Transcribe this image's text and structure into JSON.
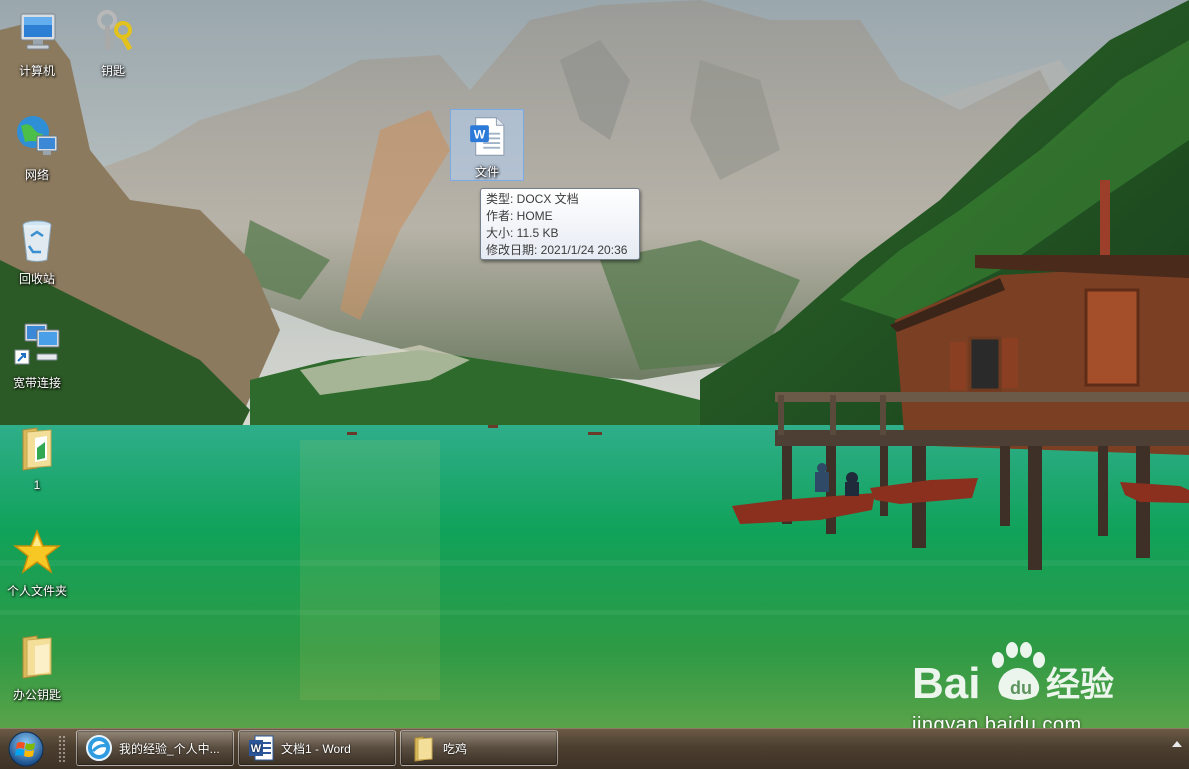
{
  "desktop": {
    "icons": [
      {
        "label": "计算机",
        "icon": "computer-icon"
      },
      {
        "label": "钥匙",
        "icon": "keys-icon"
      },
      {
        "label": "网络",
        "icon": "network-icon"
      },
      {
        "label": "回收站",
        "icon": "recycle-bin-icon"
      },
      {
        "label": "宽带连接",
        "icon": "broadband-connection-icon"
      },
      {
        "label": "1",
        "icon": "folder-icon"
      },
      {
        "label": "个人文件夹",
        "icon": "star-icon"
      },
      {
        "label": "办公钥匙",
        "icon": "folder-icon"
      },
      {
        "label": "文件",
        "icon": "word-document-icon"
      }
    ]
  },
  "tooltip": {
    "type": "类型: DOCX 文档",
    "author": "作者: HOME",
    "size": "大小: 11.5 KB",
    "modified": "修改日期: 2021/1/24 20:36"
  },
  "watermark": {
    "url": "jingyan.baidu.com"
  },
  "taskbar": {
    "start_icon": "windows-start-icon",
    "buttons": [
      {
        "label": "我的经验_个人中...",
        "icon": "browser-icon"
      },
      {
        "label": "文档1 - Word",
        "icon": "word-icon"
      },
      {
        "label": "吃鸡",
        "icon": "folder-icon"
      }
    ]
  },
  "colors": {
    "taskbar": "#4c3f30",
    "selection": "#b4d2f5",
    "word_blue": "#2b579a",
    "lake_green": "#1fa66a"
  }
}
